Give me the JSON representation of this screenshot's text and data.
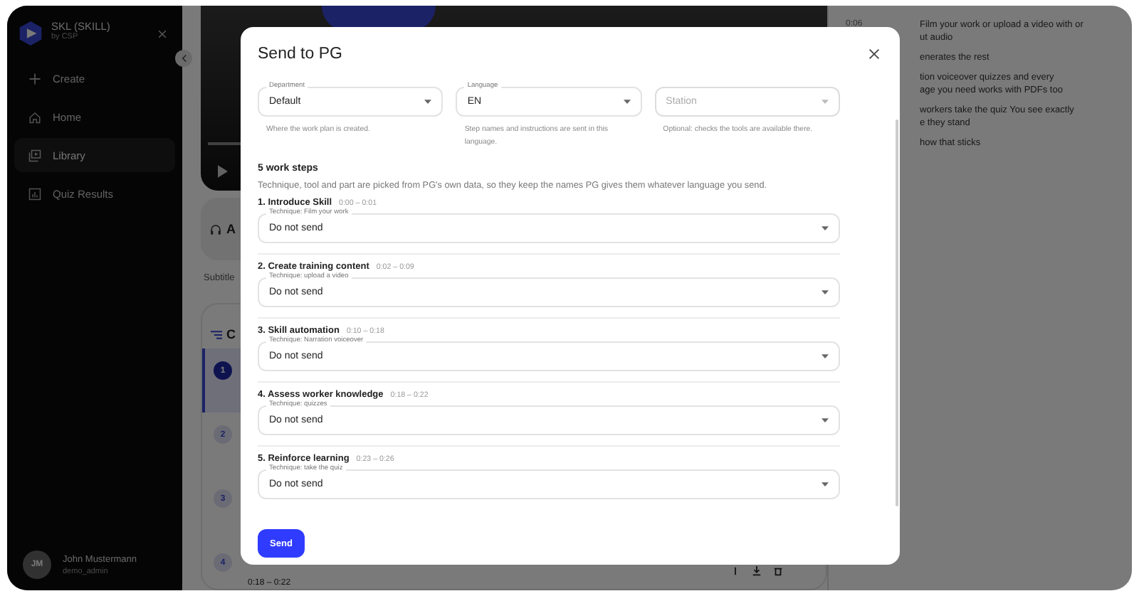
{
  "sidebar": {
    "app_name": "SKL (SKILL)",
    "app_subtitle": "by CSP",
    "items": [
      {
        "label": "Create",
        "selected": false
      },
      {
        "label": "Home",
        "selected": false
      },
      {
        "label": "Library",
        "selected": true
      },
      {
        "label": "Quiz Results",
        "selected": false
      }
    ],
    "user": {
      "initials": "JM",
      "name": "John Mustermann",
      "role": "demo_admin"
    }
  },
  "background": {
    "audio_title": "A",
    "subtitle_label": "Subtitle",
    "chapters_title": "C",
    "chapters": [
      {
        "number": "1",
        "selected": true
      },
      {
        "number": "2",
        "selected": false
      },
      {
        "number": "3",
        "selected": false
      },
      {
        "number": "4",
        "selected": false,
        "time": "0:18 – 0:22"
      }
    ],
    "transcript": [
      {
        "time": "0:06",
        "lines": [
          "Film your work or upload a video with or",
          "ut audio"
        ]
      },
      {
        "lines": [
          "enerates the rest"
        ]
      },
      {
        "lines": [
          "tion voiceover quizzes and every",
          "age you need works with PDFs too"
        ]
      },
      {
        "lines": [
          "workers take the quiz You see exactly",
          "e they stand"
        ]
      },
      {
        "lines": [
          "how that sticks"
        ]
      }
    ]
  },
  "modal": {
    "title": "Send to PG",
    "fields": [
      {
        "label": "Department",
        "value": "Default",
        "help": "Where the work plan is created."
      },
      {
        "label": "Language",
        "value": "EN",
        "help": "Step names and instructions are sent in this language."
      },
      {
        "placeholder": "Station",
        "help": "Optional: checks the tools are available there."
      }
    ],
    "steps_heading": "5 work steps",
    "steps_note": "Technique, tool and part are picked from PG's own data, so they keep the names PG gives them whatever language you send.",
    "steps": [
      {
        "title": "1. Introduce Skill",
        "time": "0:00 – 0:01",
        "technique": "Technique: Film your work",
        "value": "Do not send"
      },
      {
        "title": "2. Create training content",
        "time": "0:02 – 0:09",
        "technique": "Technique: upload a video",
        "value": "Do not send"
      },
      {
        "title": "3. Skill automation",
        "time": "0:10 – 0:18",
        "technique": "Technique: Narration voiceover",
        "value": "Do not send"
      },
      {
        "title": "4. Assess worker knowledge",
        "time": "0:18 – 0:22",
        "technique": "Technique: quizzes",
        "value": "Do not send"
      },
      {
        "title": "5. Reinforce learning",
        "time": "0:23 – 0:26",
        "technique": "Technique: take the quiz",
        "value": "Do not send"
      }
    ],
    "send": "Send"
  }
}
